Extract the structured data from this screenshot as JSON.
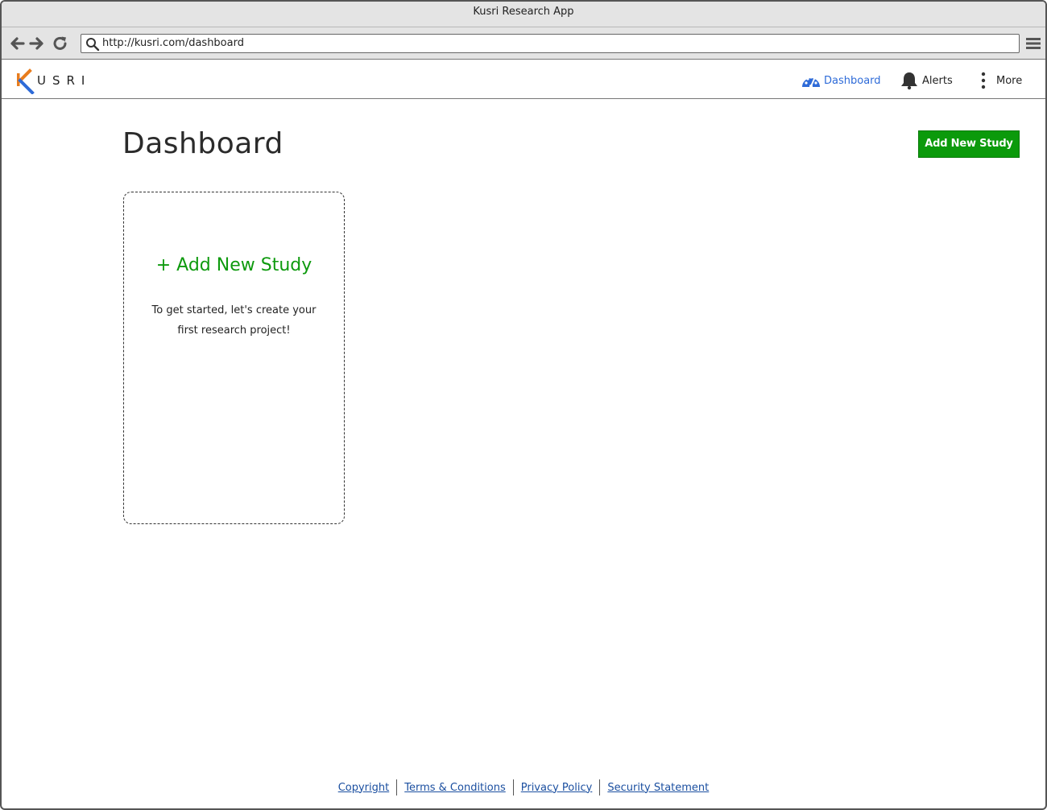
{
  "window": {
    "title": "Kusri Research App"
  },
  "browser": {
    "url": "http://kusri.com/dashboard",
    "back_icon": "arrow-left-icon",
    "forward_icon": "arrow-right-icon",
    "reload_icon": "reload-icon",
    "menu_icon": "hamburger-menu-icon"
  },
  "header": {
    "logo_text": "USRI",
    "logo_colors": {
      "orange": "#e87d1e",
      "blue": "#2e6bd8"
    },
    "nav": [
      {
        "label": "Dashboard",
        "icon": "speedometer-icon",
        "active": true
      },
      {
        "label": "Alerts",
        "icon": "bell-icon",
        "active": false
      },
      {
        "label": "More",
        "icon": "vertical-dots-icon",
        "active": false
      }
    ],
    "active_color": "#2e6bd8"
  },
  "main": {
    "title": "Dashboard",
    "add_button_label": "Add New Study",
    "add_button_color": "#0b9a0b",
    "card": {
      "title": "+ Add New Study",
      "description": "To get started, let's create your first research project!"
    }
  },
  "footer": {
    "links": [
      "Copyright",
      "Terms & Conditions",
      "Privacy Policy",
      "Security Statement"
    ]
  }
}
